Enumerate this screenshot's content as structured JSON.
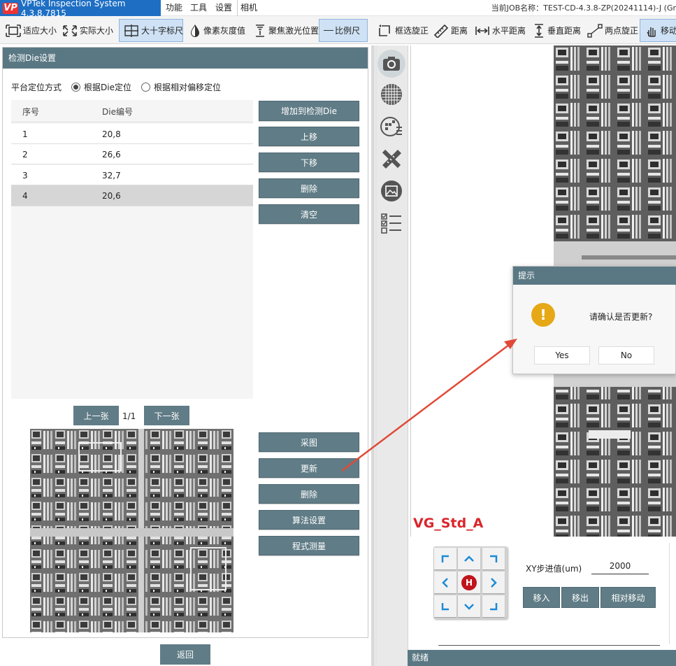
{
  "app": {
    "title": "VPTek Inspection System 4.3.8.7815",
    "logo_text": "VP",
    "menu": [
      "功能",
      "工具",
      "设置",
      "相机"
    ],
    "job_label": "当前JOB名称：TEST-CD-4.3.8-ZP(20241114)-J (Gr"
  },
  "toolbar": {
    "fit": "适应大小",
    "actual": "实际大小",
    "crosshair": "大十字标尺",
    "gray": "像素灰度值",
    "laser": "聚焦激光位置",
    "scale": "比例尺",
    "rotate_box": "框选旋正",
    "distance": "距离",
    "hdistance": "水平距离",
    "vdistance": "垂直距离",
    "two_point": "两点旋正",
    "move": "移动"
  },
  "panel": {
    "header": "检测Die设置",
    "loc_label": "平台定位方式",
    "radio_die": "根据Die定位",
    "radio_offset": "根据相对偏移定位",
    "selected_radio": "根据Die定位",
    "columns": [
      "序号",
      "Die编号"
    ],
    "rows": [
      {
        "no": "1",
        "die": "20,8"
      },
      {
        "no": "2",
        "die": "26,6"
      },
      {
        "no": "3",
        "die": "32,7"
      },
      {
        "no": "4",
        "die": "20,6"
      }
    ],
    "selected_row": "4",
    "buttons": {
      "add": "增加到检测Die",
      "up": "上移",
      "down": "下移",
      "delete": "删除",
      "clear": "清空"
    },
    "prev": "上一张",
    "next": "下一张",
    "page": "1/1",
    "image_buttons": {
      "capture": "采图",
      "update": "更新",
      "delete": "删除",
      "algo": "算法设置",
      "measure": "程式测量"
    },
    "back": "返回"
  },
  "sidebar_icons": [
    "camera-icon",
    "wafer-icon",
    "wafer-map-icon",
    "ruler-pencil-icon",
    "image-frame-icon",
    "checklist-icon"
  ],
  "viewer": {
    "recipe_label": "VG_Std_A"
  },
  "dialog": {
    "title": "提示",
    "message": "请确认是否更新?",
    "icon": "!",
    "yes": "Yes",
    "no": "No"
  },
  "stage": {
    "home": "H",
    "step_label": "XY步进值(um)",
    "step_value": "2000",
    "move_in": "移入",
    "move_out": "移出",
    "relative": "相对移动"
  },
  "status": "就绪",
  "colors": {
    "accent": "#607c86",
    "header": "#5a7883",
    "brand": "#1e6fc4",
    "warning": "#e6a817",
    "label_red": "#d9262c",
    "arrow_red": "#e04a37"
  }
}
